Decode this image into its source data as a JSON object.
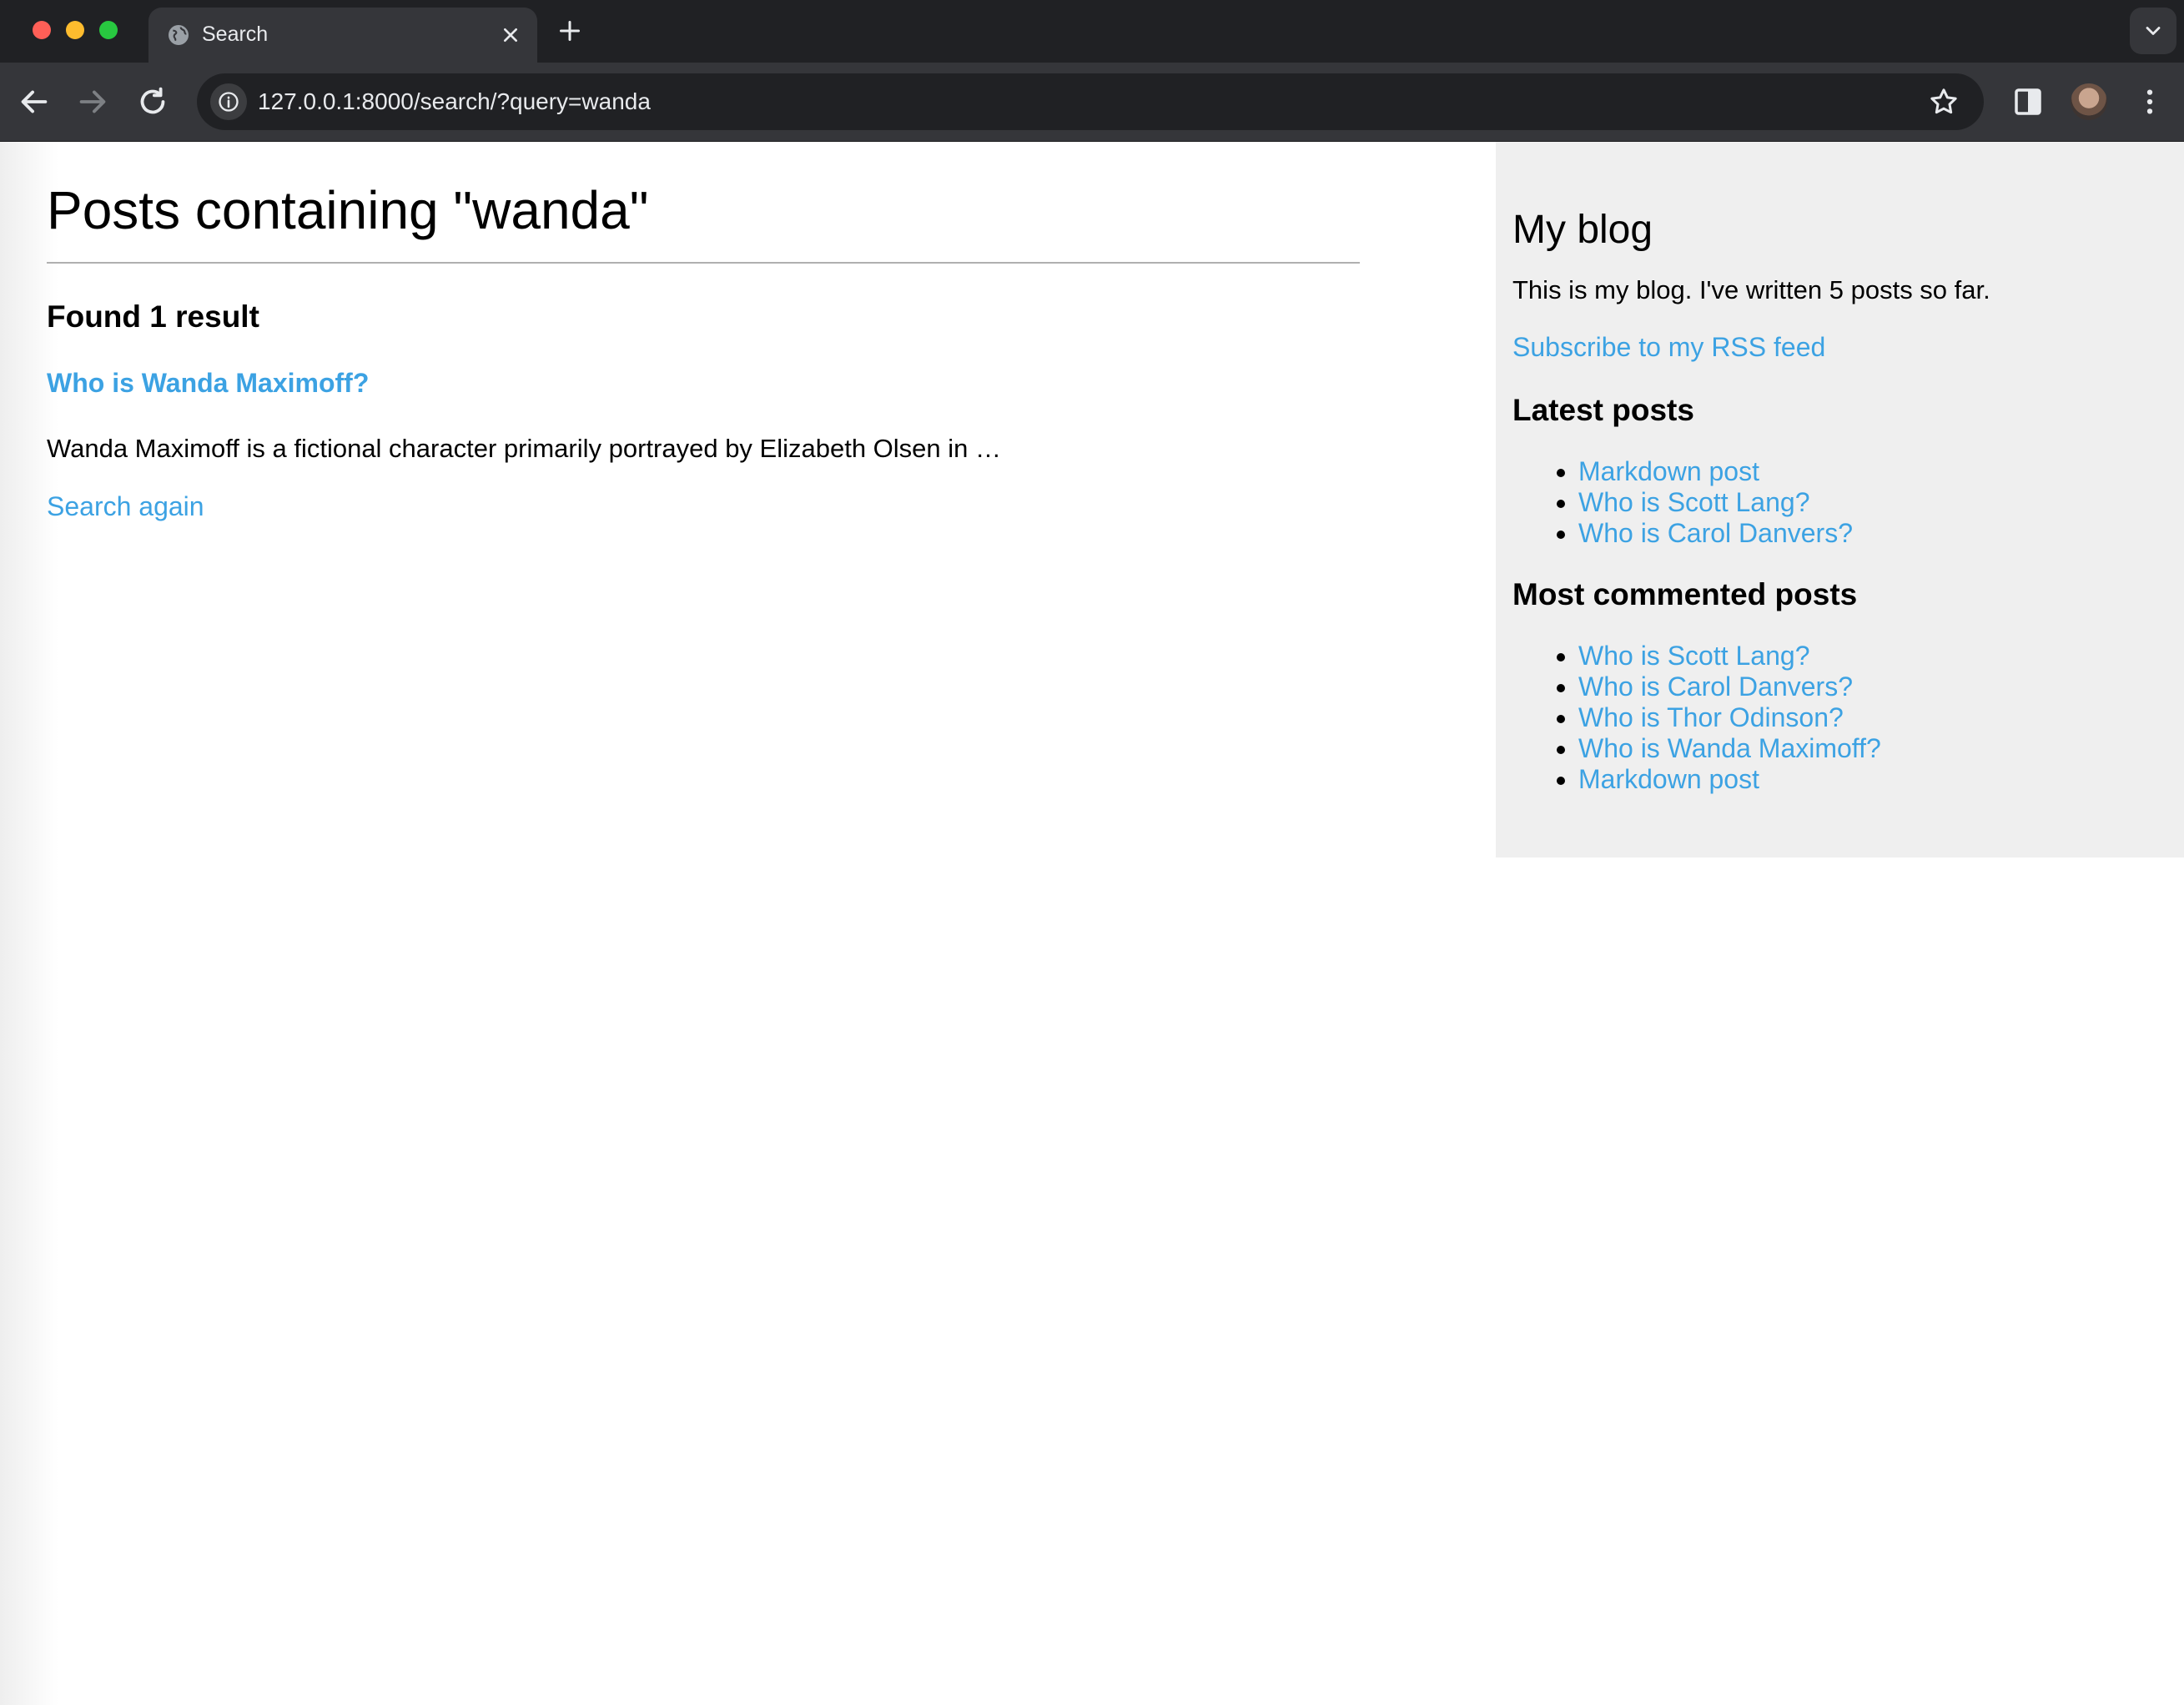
{
  "browser": {
    "tab_title": "Search",
    "url": "127.0.0.1:8000/search/?query=wanda"
  },
  "main": {
    "title": "Posts containing \"wanda\"",
    "result_count": "Found 1 result",
    "results": [
      {
        "title": "Who is Wanda Maximoff?",
        "excerpt": "Wanda Maximoff is a fictional character primarily portrayed by Elizabeth Olsen in …"
      }
    ],
    "search_again": "Search again"
  },
  "sidebar": {
    "title": "My blog",
    "description": "This is my blog. I've written 5 posts so far.",
    "rss_link": "Subscribe to my RSS feed",
    "latest_heading": "Latest posts",
    "latest_posts": [
      "Markdown post",
      "Who is Scott Lang?",
      "Who is Carol Danvers?"
    ],
    "commented_heading": "Most commented posts",
    "most_commented": [
      "Who is Scott Lang?",
      "Who is Carol Danvers?",
      "Who is Thor Odinson?",
      "Who is Wanda Maximoff?",
      "Markdown post"
    ]
  },
  "colors": {
    "link": "#3ca2e3",
    "sidebar_bg": "#efefef",
    "chrome_dark": "#202124",
    "chrome_toolbar": "#35363a"
  },
  "icons": [
    "globe-icon",
    "close-icon",
    "plus-icon",
    "chevron-down-icon",
    "back-arrow-icon",
    "forward-arrow-icon",
    "reload-icon",
    "info-icon",
    "star-icon",
    "side-panel-icon",
    "avatar",
    "kebab-menu-icon"
  ]
}
